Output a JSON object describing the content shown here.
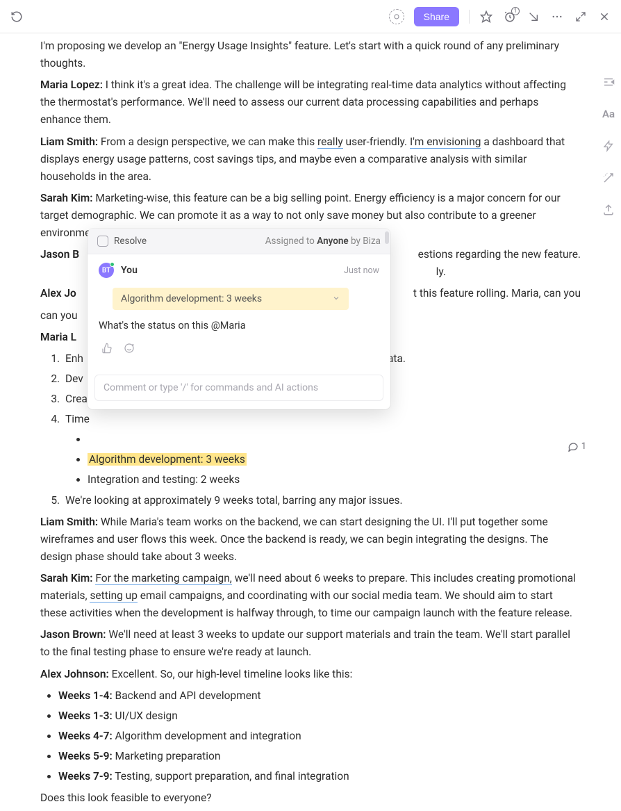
{
  "topbar": {
    "share_label": "Share",
    "clock_badge": "1"
  },
  "doc": {
    "intro_frag": "I'm proposing we develop an \"Energy Usage Insights\" feature. Let's start with a quick round of any preliminary thoughts.",
    "maria1_speaker": "Maria Lopez:",
    "maria1_text": " I think it's a great idea. The challenge will be integrating real-time data analytics without affecting the thermostat's performance. We'll need to assess our current data processing capabilities and perhaps enhance them.",
    "liam1_speaker": "Liam Smith:",
    "liam1_pre": " From a design perspective, we can make this ",
    "liam1_u1": "really",
    "liam1_mid": " user-friendly. ",
    "liam1_u2": "I'm envisioning",
    "liam1_post": " a dashboard that displays energy usage patterns, cost savings tips, and maybe even a comparative analysis with similar households in the area.",
    "sarah1_speaker": "Sarah Kim:",
    "sarah1_text": " Marketing-wise, this feature can be a big selling point. Energy efficiency is a major concern for our target demographic. We can promote it as a way to not only save money but also contribute to a greener environment.",
    "jason1_speaker": "Jason B",
    "jason1_tail": "estions regarding the new feature.",
    "jason1_tail2": "ly.",
    "alex1_speaker": "Alex Jo",
    "alex1_tail": "t this feature rolling. Maria, can you",
    "maria2_speaker": "Maria L",
    "ol1": "Enh",
    "ol1_tail": "ata.",
    "ol2": "Dev",
    "ol3": "Crea",
    "ol4": "Time",
    "sub2": "Algorithm development: 3 weeks",
    "sub3": "Integration and testing: 2 weeks",
    "ol5": "We're looking at approximately 9 weeks total, barring any major issues.",
    "liam2_speaker": "Liam Smith:",
    "liam2_text": " While Maria's team works on the backend, we can start designing the UI. I'll put together some wireframes and user flows this week. Once the backend is ready, we can begin integrating the designs. The design phase should take about 3 weeks.",
    "sarah2_speaker": "Sarah Kim:",
    "sarah2_pre": " ",
    "sarah2_u1": "For the marketing campaign,",
    "sarah2_mid": " we'll need about 6 weeks to prepare. This includes creating promotional materials, ",
    "sarah2_u2": "setting up",
    "sarah2_post": " email campaigns, and coordinating with our social media team. We should aim to start these activities when the development is halfway through, to time our campaign launch with the feature release.",
    "jason2_speaker": "Jason Brown:",
    "jason2_text": " We'll need at least 3 weeks to update our support materials and train the team. We'll start parallel to the final testing phase to ensure we're ready at launch.",
    "alex2_speaker": "Alex Johnson:",
    "alex2_text": " Excellent. So, our high-level timeline looks like this:",
    "tl": [
      {
        "b": "Weeks 1-4:",
        "t": " Backend and API development"
      },
      {
        "b": "Weeks 1-3:",
        "t": " UI/UX design"
      },
      {
        "b": "Weeks 4-7:",
        "t": " Algorithm development and integration"
      },
      {
        "b": "Weeks 5-9:",
        "t": " Marketing preparation"
      },
      {
        "b": "Weeks 7-9:",
        "t": " Testing, support preparation, and final integration"
      }
    ],
    "closing": "Does this look feasible to everyone?"
  },
  "comment_count": "1",
  "popup": {
    "resolve_label": "Resolve",
    "assigned_prefix": "Assigned to ",
    "assigned_to": "Anyone",
    "assigned_suffix": "  by Biza",
    "avatar_initials": "BT",
    "author": "You",
    "time": "Just now",
    "excerpt": "Algorithm development: 3 weeks",
    "comment_text": "What's the status on this @Maria",
    "reply_placeholder": "Comment or type '/' for commands and AI actions"
  },
  "side": {
    "aa": "Aa"
  }
}
